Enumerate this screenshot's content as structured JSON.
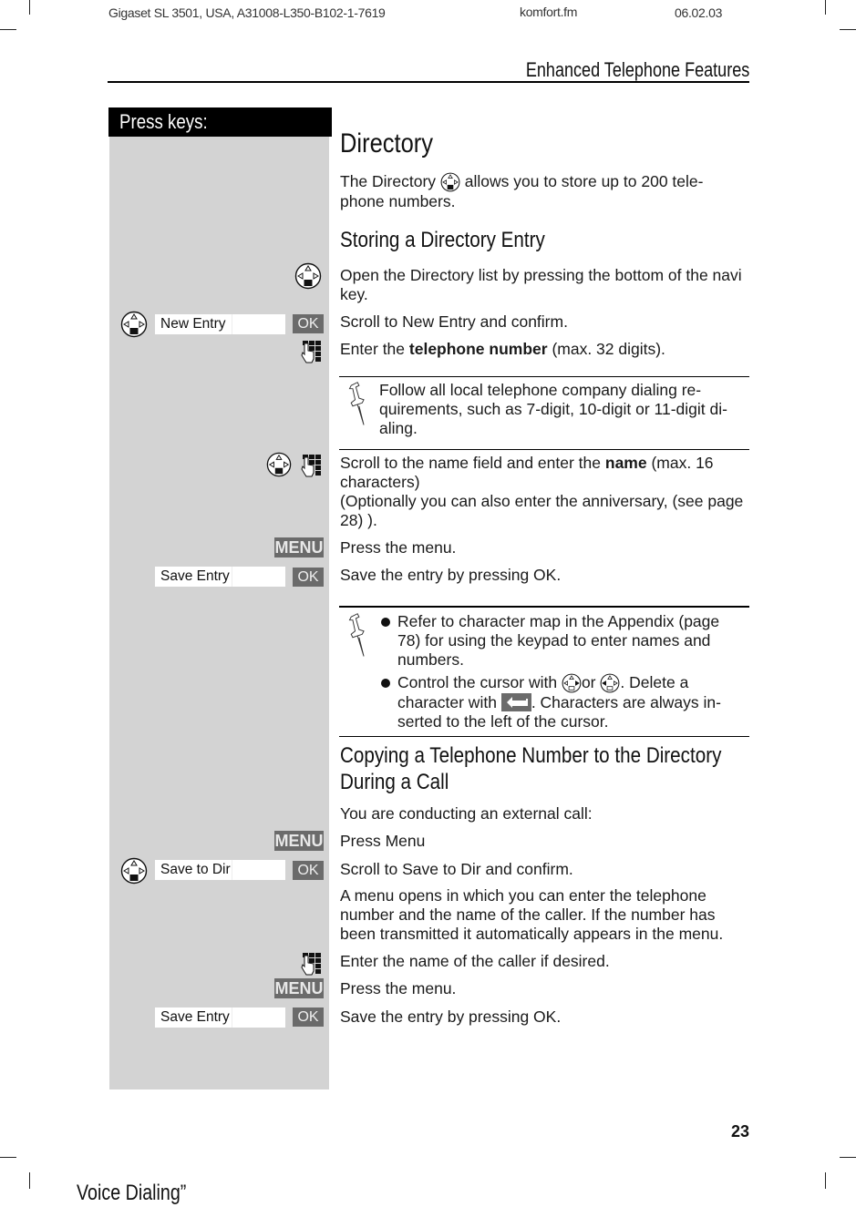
{
  "header": {
    "doc_info": "Gigaset SL 3501, USA, A31008-L350-B102-1-7619",
    "file": "komfort.fm",
    "date": "06.02.03",
    "chapter": "Enhanced Telephone Features"
  },
  "sidebar": {
    "title": "Press keys:"
  },
  "keys": {
    "ok": "OK",
    "menu": "MENU"
  },
  "displays": {
    "new_entry": "New Entry",
    "save_entry_1": "Save Entry",
    "save_to_dir": "Save to Dir",
    "save_entry_2": "Save Entry"
  },
  "content": {
    "title": "Directory",
    "intro_before": "The Directory",
    "intro_after": "allows you to store up to 200 tele-",
    "intro_line2": "phone numbers.",
    "section1_title": "Storing a Directory Entry",
    "step1": "Open the Directory list by pressing the bottom of the navi key.",
    "step2": "Scroll to New Entry and confirm.",
    "step3_prefix": "Enter the ",
    "step3_bold": "telephone number",
    "step3_suffix": " (max. 32 digits).",
    "note1": "Follow all local telephone company dialing re-quirements, such as 7-digit, 10-digit or 11-digit di-aling.",
    "step4_prefix": "Scroll to the name field and enter the ",
    "step4_bold": "name",
    "step4_suffix": " (max. 16 characters)",
    "step4_line2": "(Optionally you can also enter the anniversary, (see page 28) ).",
    "step5": "Press the menu.",
    "step6": "Save the entry by pressing OK.",
    "note2_bullet1": "Refer to character map in the Appendix (page 78) for using the keypad to enter names and numbers.",
    "note2_bullet2_a": "Control the cursor with",
    "note2_bullet2_or": "or",
    "note2_bullet2_b": ". Delete a character with",
    "note2_bullet2_c": ". Characters are always in-serted to the left of the cursor.",
    "section2_title": "Copying a Telephone Number to the Directory During a Call",
    "s2_intro": "You are conducting an external call:",
    "s2_step1": "Press Menu",
    "s2_step2": "Scroll to Save to Dir and confirm.",
    "s2_step3": "A menu opens in which you can enter the telephone number and the name of the caller. If the number has been transmitted it automatically appears in the menu.",
    "s2_step4": "Enter the name of the caller if desired.",
    "s2_step5": "Press the menu.",
    "s2_step6": "Save the entry by pressing OK."
  },
  "footer": {
    "page_number": "23",
    "overflow_text": "Voice Dialing”"
  }
}
